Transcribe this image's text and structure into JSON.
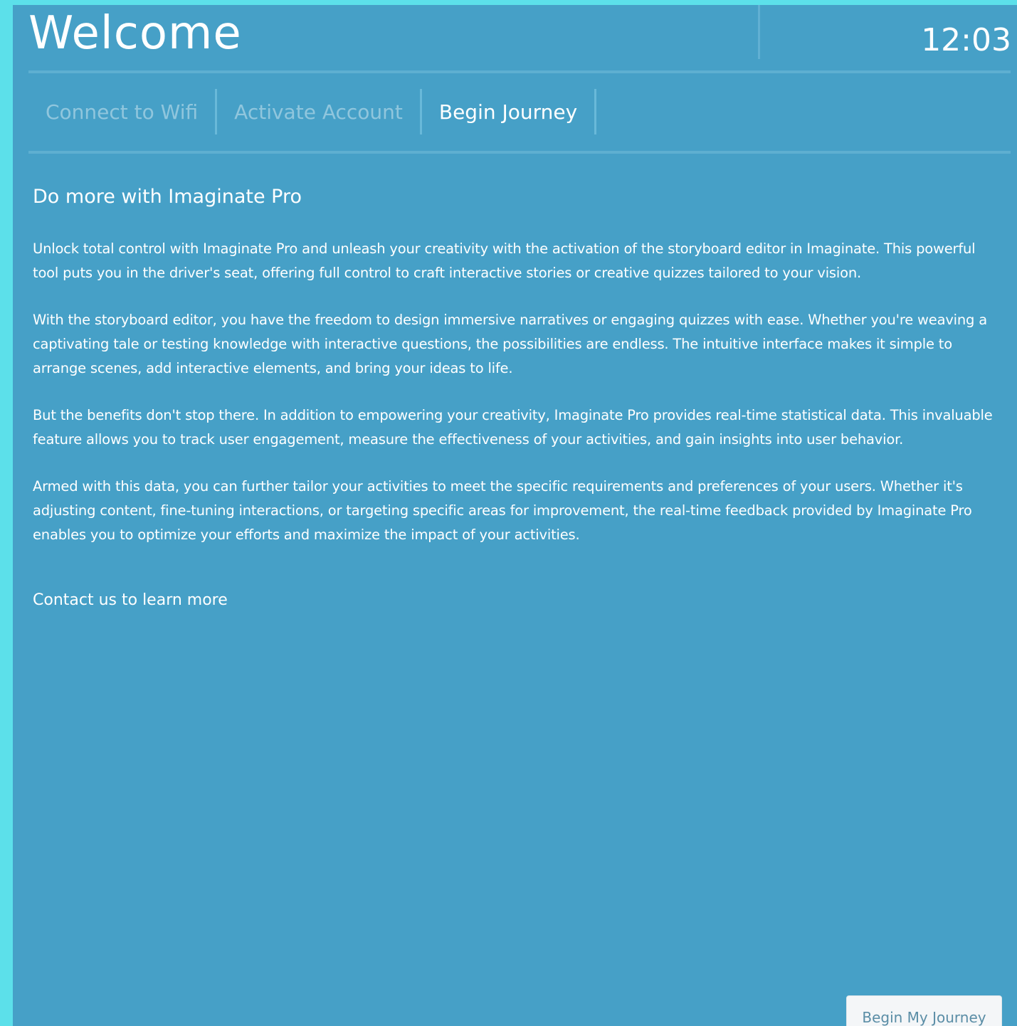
{
  "header": {
    "title": "Welcome",
    "clock": "12:03"
  },
  "tabs": [
    {
      "label": "Connect to Wifi"
    },
    {
      "label": "Activate Account"
    },
    {
      "label": "Begin Journey"
    }
  ],
  "main": {
    "heading": "Do more with Imaginate Pro",
    "paragraphs": [
      "Unlock total control with Imaginate Pro and unleash your creativity with the activation of the storyboard editor in Imaginate. This powerful tool puts you in the driver's seat, offering full control to craft interactive stories or creative quizzes tailored to your vision.",
      "With the storyboard editor, you have the freedom to design immersive narratives or engaging quizzes with ease. Whether you're weaving a captivating tale or testing knowledge with interactive questions, the possibilities are endless. The intuitive interface makes it simple to arrange scenes, add interactive elements, and bring your ideas to life.",
      "But the benefits don't stop there. In addition to empowering your creativity, Imaginate Pro provides real-time statistical data. This invaluable feature allows you to track user engagement, measure the effectiveness of your activities, and gain insights into user behavior.",
      "Armed with this data, you can further tailor your activities to meet the specific requirements and preferences of your users. Whether it's adjusting content, fine-tuning interactions, or targeting specific areas for improvement, the real-time feedback provided by Imaginate Pro enables you to optimize your efforts and maximize the impact of your activities."
    ],
    "contact_link": "Contact us to learn more"
  },
  "footer": {
    "cta_label": "Begin My Journey"
  },
  "colors": {
    "outer_background": "#5ce0ea",
    "panel_background": "#46a0c7",
    "text": "#ffffff",
    "button_background": "#f4f6f8",
    "button_text": "#5a8da6"
  }
}
